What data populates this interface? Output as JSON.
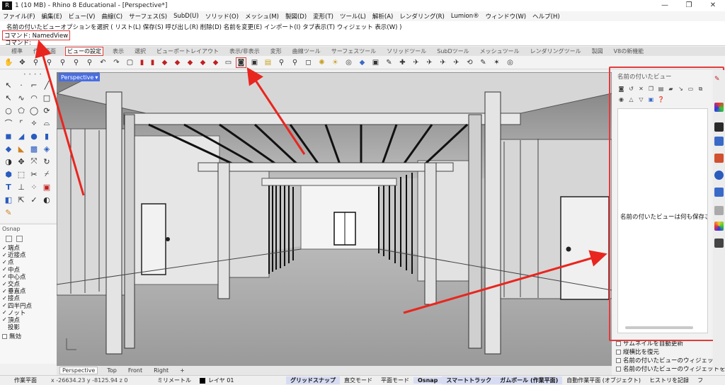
{
  "window": {
    "title": "1 (10 MB) - Rhino 8 Educational - [Perspective*]",
    "app_icon_glyph": "R",
    "controls": [
      "—",
      "❐",
      "✕"
    ]
  },
  "menubar": [
    "ファイル(F)",
    "編集(E)",
    "ビュー(V)",
    "曲線(C)",
    "サーフェス(S)",
    "SubD(U)",
    "ソリッド(O)",
    "メッシュ(M)",
    "製図(D)",
    "変形(T)",
    "ツール(L)",
    "解析(A)",
    "レンダリング(R)",
    "Lumion®",
    "ウィンドウ(W)",
    "ヘルプ(H)"
  ],
  "command": {
    "options": "名前の付いたビューオプションを選択 ( リスト(L)  保存(S)  呼び出し(R)  削除(D)  名前を変更(E)  インポート(I)  タブ表示(T)  ウィジェット 表示(W) )",
    "history": "コマンド: NamedView",
    "prompt": "コマンド:"
  },
  "tabs": [
    "標準",
    "作業平面",
    "ビューの設定",
    "表示",
    "選択",
    "ビューポートレイアウト",
    "表示/非表示",
    "変形",
    "曲線ツール",
    "サーフェスツール",
    "ソリッドツール",
    "SubDツール",
    "メッシュツール",
    "レンダリングツール",
    "製図",
    "V8の新機能"
  ],
  "active_tab_index": 2,
  "toolbar_icons": [
    "pan-icon",
    "rotate-icon",
    "zoom-window-icon",
    "zoom-extents-icon",
    "zoom-selected-icon",
    "zoom-icon",
    "zoom-extents-all-icon",
    "undo-view-icon",
    "redo-view-icon",
    "copy-view-icon",
    "set-view-icon",
    "screen-view-icon",
    "car-icon",
    "car-icon",
    "car-icon",
    "car-icon",
    "car-icon",
    "car-icon",
    "camera-drive-icon",
    "named-view-camera-icon",
    "named-cplane-icon",
    "viewport-icon",
    "layout-icon",
    "zoom-target-icon",
    "zoom-target-icon",
    "light-icon",
    "sun-icon",
    "target-icon",
    "render-icon",
    "box-icon",
    "brush-icon",
    "joystick-icon",
    "plane-icon",
    "plane-icon",
    "plane-icon",
    "plane-icon",
    "rotate-360-icon",
    "pen-icon",
    "star-icon",
    "compass-icon"
  ],
  "viewport": {
    "label": "Perspective",
    "tabs": [
      "Perspective",
      "Top",
      "Front",
      "Right",
      "+"
    ],
    "active_tab": 0
  },
  "osnap": {
    "title": "Osnap",
    "items": [
      {
        "label": "端点",
        "checked": true
      },
      {
        "label": "近接点",
        "checked": true
      },
      {
        "label": "点",
        "checked": true
      },
      {
        "label": "中点",
        "checked": true
      },
      {
        "label": "中心点",
        "checked": true
      },
      {
        "label": "交点",
        "checked": true
      },
      {
        "label": "垂直点",
        "checked": true
      },
      {
        "label": "接点",
        "checked": true
      },
      {
        "label": "四半円点",
        "checked": true
      },
      {
        "label": "ノット",
        "checked": true
      },
      {
        "label": "頂点",
        "checked": true
      },
      {
        "label": "投影",
        "checked": false
      }
    ],
    "disable_label": "無効"
  },
  "named_views": {
    "title": "名前の付いたビュー",
    "empty_message": "名前の付いたビューは何も保存されて",
    "options": [
      "サムネイルを自動更新",
      "縦横比を復元",
      "名前の付いたビューのウィジェットを",
      "名前の付いたビューのウィジェットを"
    ]
  },
  "status": {
    "work_plane": "作業平面",
    "coords": "x -26634.23  y -8125.94  z 0",
    "units": "ミリメートル",
    "layer": "レイヤ 01",
    "buttons": [
      "グリッドスナップ",
      "直交モード",
      "平面モード",
      "Osnap",
      "スマートトラック",
      "ガムボール (作業平面)",
      "自動作業平面 (オブジェクト)",
      "ヒストリを記録",
      "フ"
    ]
  }
}
